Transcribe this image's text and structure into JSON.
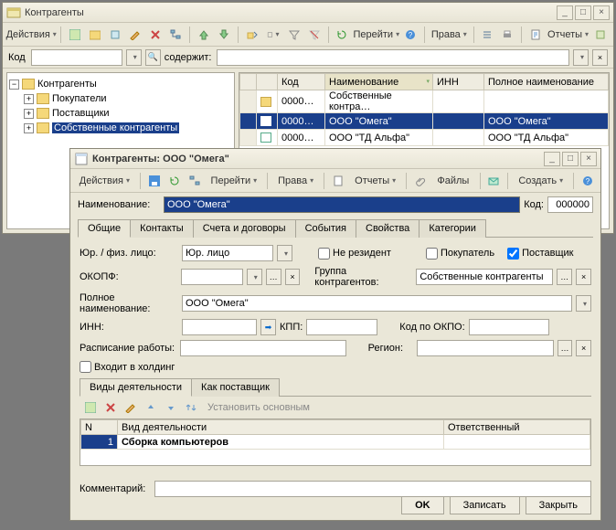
{
  "main": {
    "title": "Контрагенты",
    "toolbar": {
      "actions": "Действия"
    },
    "nav": {
      "goto": "Перейти",
      "rights": "Права",
      "reports": "Отчеты"
    },
    "search": {
      "code_label": "Код",
      "contains": "содержит:",
      "code_value": "",
      "contains_value": ""
    },
    "tree": {
      "root": "Контрагенты",
      "items": [
        "Покупатели",
        "Поставщики",
        "Собственные контрагенты"
      ]
    },
    "grid": {
      "cols": [
        "",
        "Код",
        "Наименование",
        "ИНН",
        "Полное наименование"
      ],
      "rows": [
        {
          "type": "folder",
          "code": "0000…",
          "name": "Собственные контра…",
          "inn": "",
          "full": ""
        },
        {
          "type": "item",
          "code": "0000…",
          "name": "ООО \"Омега\"",
          "inn": "",
          "full": "ООО \"Омега\"",
          "selected": true
        },
        {
          "type": "item",
          "code": "0000…",
          "name": "ООО \"ТД Альфа\"",
          "inn": "",
          "full": "ООО \"ТД Альфа\""
        }
      ]
    }
  },
  "dlg": {
    "title": "Контрагенты: ООО \"Омега\"",
    "toolbar": {
      "actions": "Действия",
      "goto": "Перейти",
      "rights": "Права",
      "reports": "Отчеты",
      "files": "Файлы",
      "create": "Создать"
    },
    "name_label": "Наименование:",
    "name_value": "ООО \"Омега\"",
    "code_label": "Код:",
    "code_value": "000000",
    "tabs": [
      "Общие",
      "Контакты",
      "Счета и договоры",
      "События",
      "Свойства",
      "Категории"
    ],
    "form": {
      "legal_label": "Юр. / физ. лицо:",
      "legal_value": "Юр. лицо",
      "nonresident": "Не резидент",
      "buyer": "Покупатель",
      "supplier": "Поставщик",
      "supplier_checked": true,
      "okopf_label": "ОКОПФ:",
      "okopf_value": "",
      "group_label": "Группа контрагентов:",
      "group_value": "Собственные контрагенты",
      "fullname_label": "Полное наименование:",
      "fullname_value": "ООО \"Омега\"",
      "inn_label": "ИНН:",
      "inn_value": "",
      "kpp_label": "КПП:",
      "kpp_value": "",
      "okpo_label": "Код по ОКПО:",
      "okpo_value": "",
      "schedule_label": "Расписание работы:",
      "schedule_value": "",
      "region_label": "Регион:",
      "region_value": "",
      "holding": "Входит в холдинг"
    },
    "subtabs": [
      "Виды деятельности",
      "Как поставщик"
    ],
    "subtoolbar": {
      "set_main": "Установить основным"
    },
    "subgrid": {
      "cols": [
        "N",
        "Вид деятельности",
        "Ответственный"
      ],
      "rows": [
        {
          "n": "1",
          "activity": "Сборка компьютеров",
          "resp": ""
        }
      ]
    },
    "comment_label": "Комментарий:",
    "comment_value": "",
    "footer": {
      "ok": "OK",
      "save": "Записать",
      "close": "Закрыть"
    }
  }
}
